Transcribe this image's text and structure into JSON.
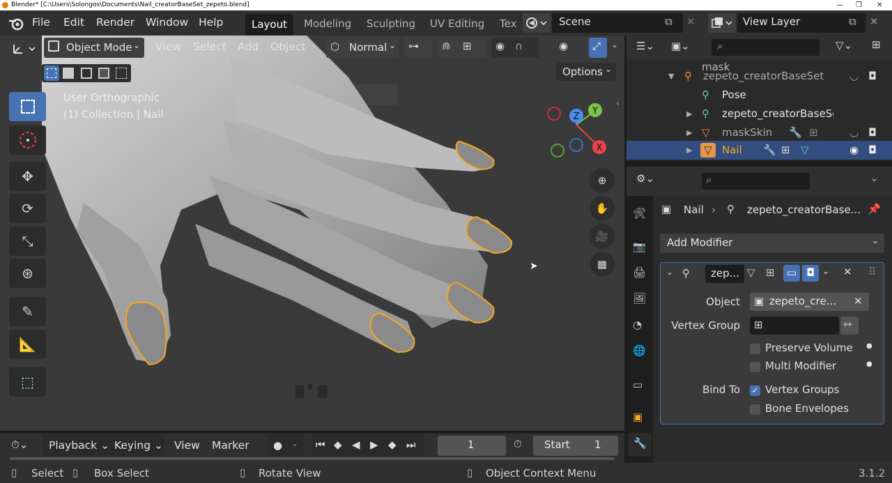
{
  "window": {
    "title": "Blender* [C:\\Users\\Solongos\\Documents\\Nail_creatorBaseSet_zepeto.blend]",
    "controls": [
      "—",
      "❐",
      "✕"
    ]
  },
  "topbar": {
    "menus": [
      "File",
      "Edit",
      "Render",
      "Window",
      "Help"
    ],
    "workspaces": [
      "Layout",
      "Modeling",
      "Sculpting",
      "UV Editing",
      "Tex"
    ],
    "active_workspace": "Layout",
    "scene": "Scene",
    "view_layer": "View Layer"
  },
  "viewport": {
    "mode": "Object Mode",
    "menus": [
      "View",
      "Select",
      "Add",
      "Object"
    ],
    "orientation": "Normal",
    "options_label": "Options",
    "view_name": "User Orthographic",
    "collection_info": "(1) Collection | Nail",
    "gizmo_axes": [
      "Z",
      "Y",
      "X"
    ]
  },
  "outliner": {
    "search_placeholder": "",
    "rows": [
      {
        "label": "mask",
        "type": "armature"
      },
      {
        "label": "zepeto_creatorBaseSet",
        "type": "armature"
      },
      {
        "label": "Pose",
        "type": "pose"
      },
      {
        "label": "zepeto_creatorBaseSe",
        "type": "armature-data"
      },
      {
        "label": "maskSkin",
        "type": "mesh"
      },
      {
        "label": "Nail",
        "type": "mesh",
        "selected": true
      }
    ]
  },
  "properties": {
    "breadcrumb_object": "Nail",
    "breadcrumb_modifier": "zepeto_creatorBase...",
    "add_modifier": "Add Modifier",
    "modifier": {
      "name": "zep...",
      "object_label": "Object",
      "object_value": "zepeto_cre...",
      "vertex_group_label": "Vertex Group",
      "vertex_group_value": "",
      "preserve_volume": {
        "label": "Preserve Volume",
        "checked": false
      },
      "multi_modifier": {
        "label": "Multi Modifier",
        "checked": false
      },
      "bind_to_label": "Bind To",
      "vertex_groups": {
        "label": "Vertex Groups",
        "checked": true
      },
      "bone_envelopes": {
        "label": "Bone Envelopes",
        "checked": false
      }
    }
  },
  "timeline": {
    "menus": [
      "Playback",
      "Keying",
      "View",
      "Marker"
    ],
    "current_frame": "1",
    "start_label": "Start",
    "start_value": "1"
  },
  "statusbar": {
    "items": [
      "Select",
      "Box Select",
      "Rotate View",
      "Object Context Menu"
    ],
    "version": "3.1.2"
  },
  "colors": {
    "accent": "#4772b3",
    "selection_outline": "#f5a623",
    "header_bg": "#303030",
    "panel_bg": "#2b2b2b"
  }
}
